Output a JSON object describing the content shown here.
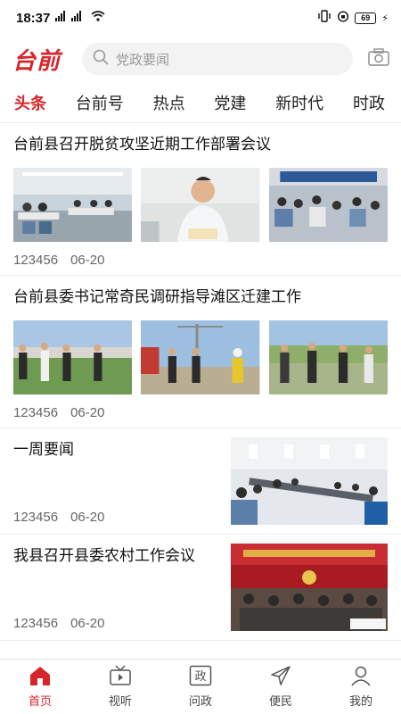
{
  "status_bar": {
    "time": "18:37",
    "battery": "69"
  },
  "header": {
    "logo": "台前",
    "search_placeholder": "党政要闻"
  },
  "tabs": [
    "头条",
    "台前号",
    "热点",
    "党建",
    "新时代",
    "时政"
  ],
  "articles": [
    {
      "title": "台前县召开脱贫攻坚近期工作部署会议",
      "views": "123456",
      "date": "06-20",
      "thumbs": [
        "meeting-room",
        "speaker-at-podium",
        "conference-hall"
      ]
    },
    {
      "title": "台前县委书记常奇民调研指导滩区迁建工作",
      "views": "123456",
      "date": "06-20",
      "thumbs": [
        "officials-in-field",
        "construction-site-visit",
        "officials-at-site"
      ]
    },
    {
      "title": "一周要闻",
      "views": "123456",
      "date": "06-20",
      "thumbs": [
        "meeting-room"
      ]
    },
    {
      "title": "我县召开县委农村工作会议",
      "views": "123456",
      "date": "06-20",
      "thumbs": [
        "conference-stage"
      ]
    }
  ],
  "bottom_nav": [
    {
      "label": "首页",
      "icon": "home-icon"
    },
    {
      "label": "视听",
      "icon": "tv-icon"
    },
    {
      "label": "问政",
      "icon": "government-icon"
    },
    {
      "label": "便民",
      "icon": "send-icon"
    },
    {
      "label": "我的",
      "icon": "user-icon"
    }
  ],
  "colors": {
    "accent": "#d7262b",
    "text": "#111111",
    "meta": "#666666",
    "divider": "#ececec"
  }
}
